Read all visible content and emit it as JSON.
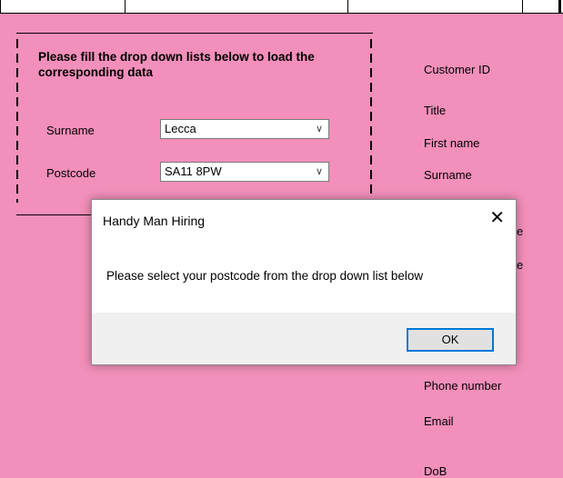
{
  "group": {
    "title": "Please fill the drop down lists below to load the corresponding data",
    "surname_label": "Surname",
    "surname_value": "Lecca",
    "postcode_label": "Postcode",
    "postcode_value": "SA11 8PW"
  },
  "right_fields": {
    "customer_id": "Customer ID",
    "title": "Title",
    "first_name": "First name",
    "surname": "Surname",
    "partial_1": "e",
    "partial_2": "e",
    "phone_number": "Phone number",
    "email": "Email",
    "dob": "DoB"
  },
  "dialog": {
    "title": "Handy Man Hiring",
    "close_glyph": "✕",
    "message": "Please select your postcode from the drop down list below",
    "ok_label": "OK"
  },
  "icons": {
    "dropdown": "chevron-down-icon",
    "close": "close-icon"
  }
}
